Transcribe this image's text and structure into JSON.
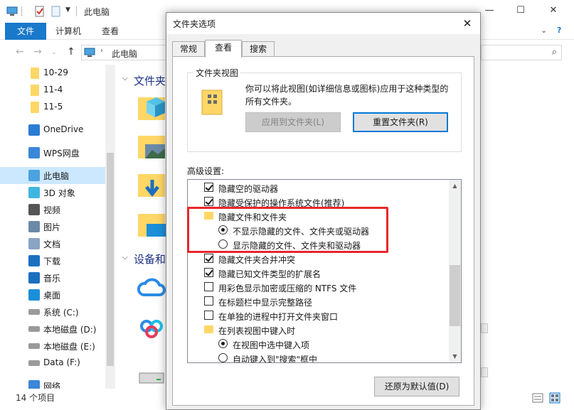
{
  "explorer": {
    "title": "此电脑",
    "ribbon": {
      "file": "文件",
      "computer": "计算机",
      "view": "查看"
    },
    "address": "此电脑",
    "nav": [
      {
        "label": "10-29",
        "icon": "folder-icon"
      },
      {
        "label": "11-4",
        "icon": "folder-icon"
      },
      {
        "label": "11-5",
        "icon": "folder-icon"
      },
      {
        "label": "OneDrive",
        "icon": "cloud-icon"
      },
      {
        "label": "WPS网盘",
        "icon": "wps-cloud-icon"
      },
      {
        "label": "此电脑",
        "icon": "computer-icon",
        "selected": true
      },
      {
        "label": "3D 对象",
        "icon": "cube-icon"
      },
      {
        "label": "视频",
        "icon": "video-icon"
      },
      {
        "label": "图片",
        "icon": "picture-icon"
      },
      {
        "label": "文档",
        "icon": "document-icon"
      },
      {
        "label": "下载",
        "icon": "download-icon"
      },
      {
        "label": "音乐",
        "icon": "music-icon"
      },
      {
        "label": "桌面",
        "icon": "desktop-icon"
      },
      {
        "label": "系统 (C:)",
        "icon": "drive-icon"
      },
      {
        "label": "本地磁盘 (D:)",
        "icon": "drive-icon"
      },
      {
        "label": "本地磁盘 (E:)",
        "icon": "drive-icon"
      },
      {
        "label": "Data (F:)",
        "icon": "drive-icon"
      },
      {
        "label": "网络",
        "icon": "network-icon"
      }
    ],
    "sections": {
      "folders": "文件夹",
      "devices": "设备和"
    },
    "status": "14 个项目"
  },
  "dialog": {
    "title": "文件夹选项",
    "close": "✕",
    "tabs": [
      "常规",
      "查看",
      "搜索"
    ],
    "group_title": "文件夹视图",
    "group_desc": "你可以将此视图(如详细信息或图标)应用于这种类型的所有文件夹。",
    "apply_btn": "应用到文件夹(L)",
    "reset_btn": "重置文件夹(R)",
    "advanced_label": "高级设置:",
    "tree": [
      {
        "type": "checkbox",
        "checked": true,
        "label": "隐藏空的驱动器"
      },
      {
        "type": "checkbox",
        "checked": true,
        "label": "隐藏受保护的操作系统文件(推荐)"
      },
      {
        "type": "folder",
        "label": "隐藏文件和文件夹"
      },
      {
        "type": "radio",
        "checked": true,
        "label": "不显示隐藏的文件、文件夹或驱动器"
      },
      {
        "type": "radio",
        "checked": false,
        "label": "显示隐藏的文件、文件夹和驱动器"
      },
      {
        "type": "checkbox",
        "checked": true,
        "label": "隐藏文件夹合并冲突"
      },
      {
        "type": "checkbox",
        "checked": true,
        "label": "隐藏已知文件类型的扩展名"
      },
      {
        "type": "checkbox",
        "checked": false,
        "label": "用彩色显示加密或压缩的 NTFS 文件"
      },
      {
        "type": "checkbox",
        "checked": false,
        "label": "在标题栏中显示完整路径"
      },
      {
        "type": "checkbox",
        "checked": false,
        "label": "在单独的进程中打开文件夹窗口"
      },
      {
        "type": "folder",
        "label": "在列表视图中键入时"
      },
      {
        "type": "radio",
        "checked": true,
        "label": "在视图中选中键入项"
      },
      {
        "type": "radio",
        "checked": false,
        "label": "自动键入到\"搜索\"框中"
      }
    ],
    "restore_btn": "还原为默认值(D)"
  },
  "colors": {
    "accent": "#1979ca",
    "highlight": "#e8262b",
    "selection": "#cce8ff"
  }
}
